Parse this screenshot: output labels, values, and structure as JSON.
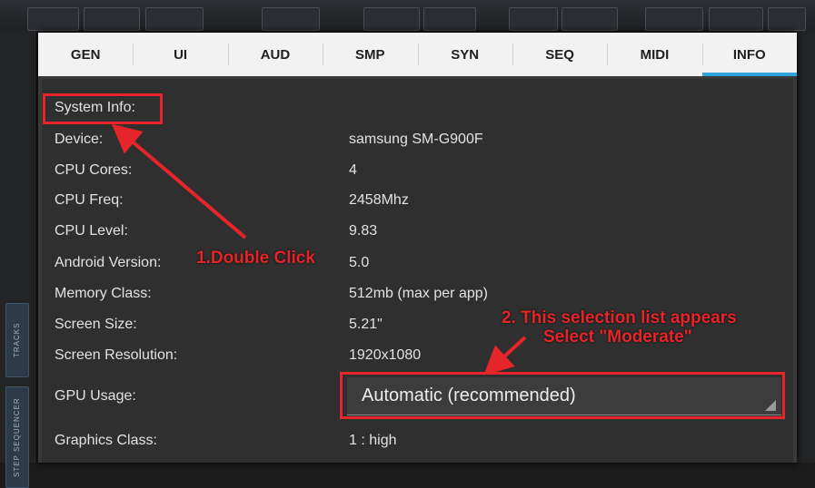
{
  "tabs": [
    {
      "label": "GEN"
    },
    {
      "label": "UI"
    },
    {
      "label": "AUD"
    },
    {
      "label": "SMP"
    },
    {
      "label": "SYN"
    },
    {
      "label": "SEQ"
    },
    {
      "label": "MIDI"
    },
    {
      "label": "INFO",
      "active": true
    }
  ],
  "background": {
    "side_tabs": [
      "TRACKS",
      "STEP SEQUENCER"
    ]
  },
  "info": {
    "header": "System Info:",
    "rows": [
      {
        "label": "Device:",
        "value": "samsung SM-G900F"
      },
      {
        "label": "CPU Cores:",
        "value": "4"
      },
      {
        "label": "CPU Freq:",
        "value": "2458Mhz"
      },
      {
        "label": "CPU Level:",
        "value": "9.83"
      },
      {
        "label": "Android Version:",
        "value": "5.0"
      },
      {
        "label": "Memory Class:",
        "value": "512mb (max per app)"
      },
      {
        "label": "Screen Size:",
        "value": "5.21\""
      },
      {
        "label": "Screen Resolution:",
        "value": "1920x1080"
      },
      {
        "label": "GPU Usage:",
        "value": "Automatic (recommended)"
      },
      {
        "label": "Graphics Class:",
        "value": "1 : high"
      }
    ]
  },
  "annotations": {
    "step1": "1.Double Click",
    "step2_line1": "2. This selection list appears",
    "step2_line2": "Select \"Moderate\""
  },
  "colors": {
    "accent": "#2fa4dc",
    "annotation": "#e5252a",
    "panel": "#2f2f2f",
    "tabbar": "#f2f2f2"
  }
}
